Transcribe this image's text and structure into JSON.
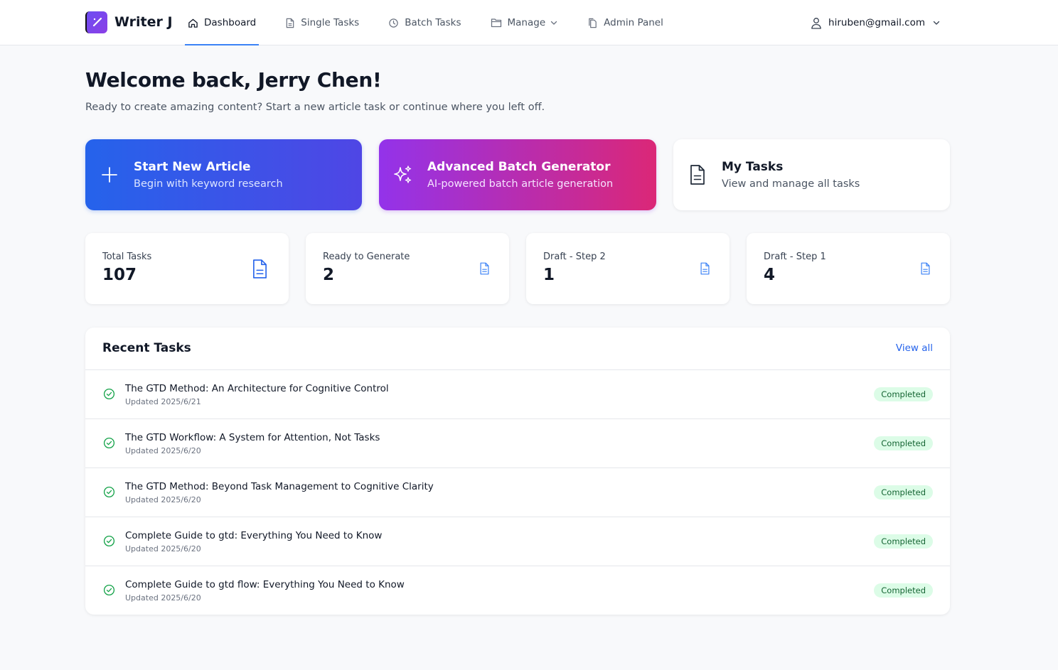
{
  "app": {
    "name": "Writer J"
  },
  "nav": [
    {
      "label": "Dashboard",
      "icon": "home-icon",
      "active": true
    },
    {
      "label": "Single Tasks",
      "icon": "document-icon"
    },
    {
      "label": "Batch Tasks",
      "icon": "clock-icon"
    },
    {
      "label": "Manage",
      "icon": "folder-icon",
      "dropdown": true
    },
    {
      "label": "Admin Panel",
      "icon": "copy-icon"
    }
  ],
  "user": {
    "email": "hiruben@gmail.com"
  },
  "welcome": {
    "title": "Welcome back, Jerry Chen!",
    "subtitle": "Ready to create amazing content? Start a new article task or continue where you left off."
  },
  "actions": [
    {
      "title": "Start New Article",
      "subtitle": "Begin with keyword research",
      "icon": "plus-icon"
    },
    {
      "title": "Advanced Batch Generator",
      "subtitle": "AI-powered batch article generation",
      "icon": "sparkles-icon"
    },
    {
      "title": "My Tasks",
      "subtitle": "View and manage all tasks",
      "icon": "document-icon"
    }
  ],
  "stats": [
    {
      "label": "Total Tasks",
      "value": "107"
    },
    {
      "label": "Ready to Generate",
      "value": "2"
    },
    {
      "label": "Draft - Step 2",
      "value": "1"
    },
    {
      "label": "Draft - Step 1",
      "value": "4"
    }
  ],
  "recent": {
    "title": "Recent Tasks",
    "view_all": "View all",
    "tasks": [
      {
        "title": "The GTD Method: An Architecture for Cognitive Control",
        "updated": "Updated 2025/6/21",
        "status": "Completed"
      },
      {
        "title": "The GTD Workflow: A System for Attention, Not Tasks",
        "updated": "Updated 2025/6/20",
        "status": "Completed"
      },
      {
        "title": "The GTD Method: Beyond Task Management to Cognitive Clarity",
        "updated": "Updated 2025/6/20",
        "status": "Completed"
      },
      {
        "title": "Complete Guide to gtd: Everything You Need to Know",
        "updated": "Updated 2025/6/20",
        "status": "Completed"
      },
      {
        "title": "Complete Guide to gtd flow: Everything You Need to Know",
        "updated": "Updated 2025/6/20",
        "status": "Completed"
      }
    ]
  },
  "colors": {
    "accent": "#2563eb",
    "purple": "#9333ea",
    "pink": "#db2777",
    "success": "#16a34a",
    "success_bg": "#dcfce7"
  }
}
